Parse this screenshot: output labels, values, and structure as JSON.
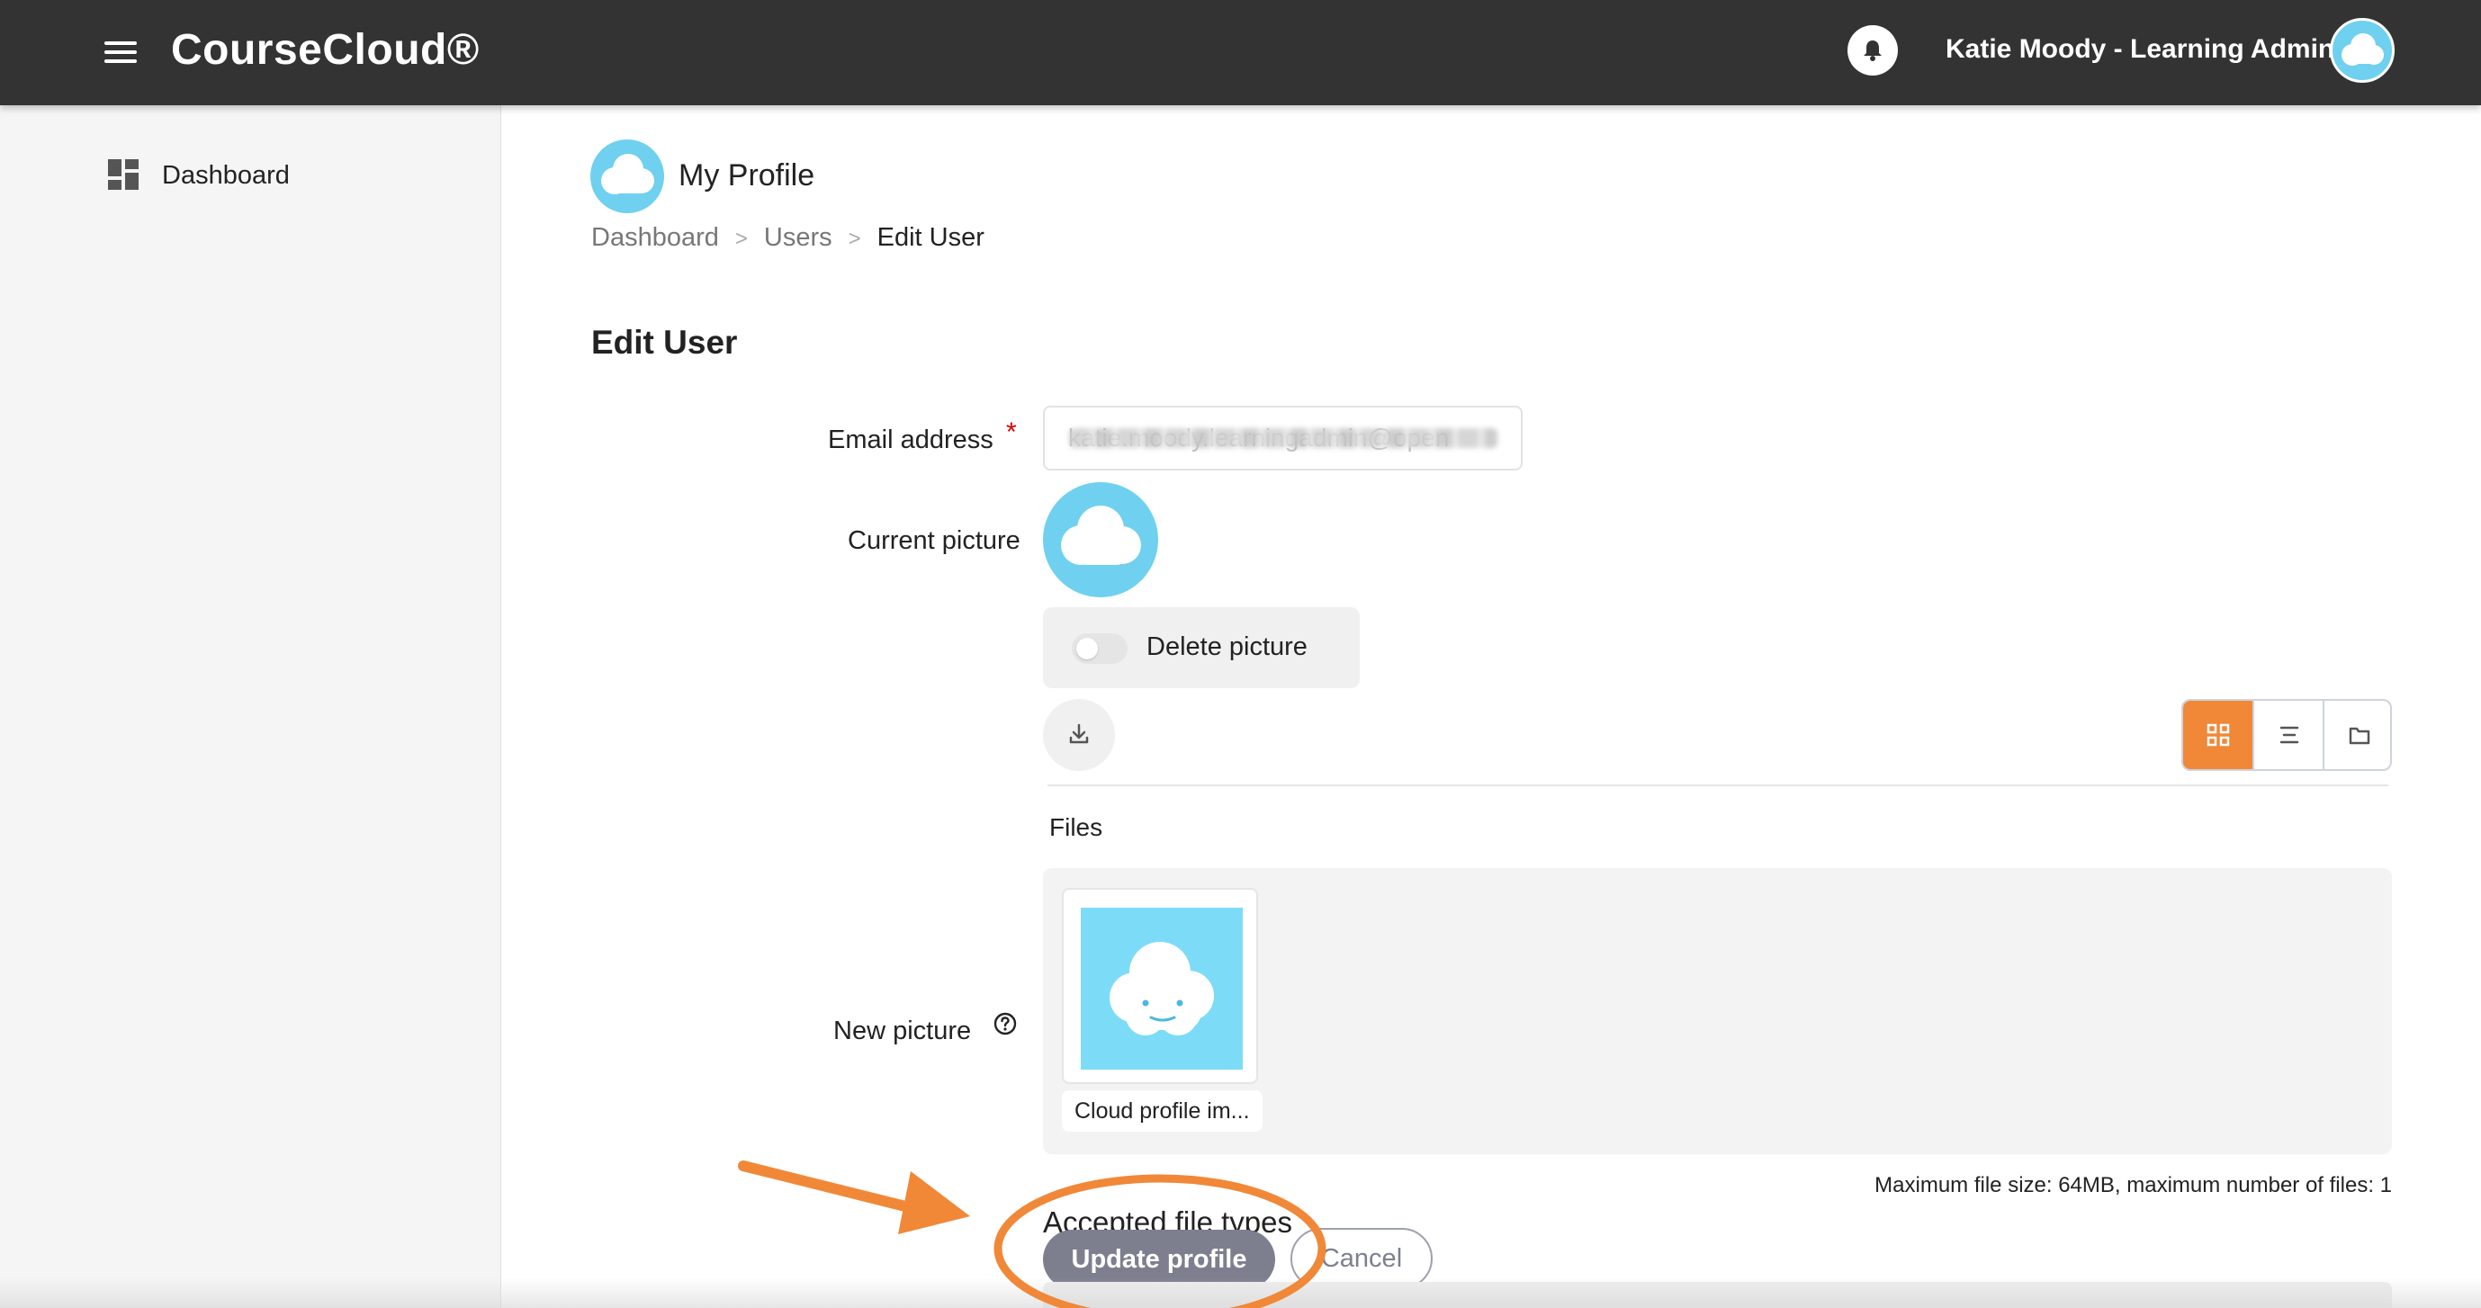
{
  "app": {
    "brand": "CourseCloud®",
    "user_name": "Katie Moody - Learning Admin"
  },
  "sidebar": {
    "items": [
      {
        "label": "Dashboard",
        "icon": "dashboard-grid-icon"
      }
    ]
  },
  "page": {
    "heading": "My Profile",
    "breadcrumb": [
      "Dashboard",
      "Users",
      "Edit User"
    ],
    "section_title": "Edit User"
  },
  "form": {
    "email_label": "Email address",
    "email_value": "katie.moody.learningadmin@open",
    "required_mark": "*",
    "current_picture_label": "Current picture",
    "delete_picture_label": "Delete picture",
    "new_picture_label": "New picture",
    "files_label": "Files",
    "file_name": "Cloud profile im...",
    "limits_text": "Maximum file size: 64MB, maximum number of files: 1",
    "accepted_types_label": "Accepted file types",
    "update_button": "Update profile",
    "cancel_button": "Cancel"
  },
  "colors": {
    "topbar": "#333333",
    "accent": "#f08838",
    "avatar": "#6fd0f0",
    "update_button": "#7d7f8f"
  }
}
